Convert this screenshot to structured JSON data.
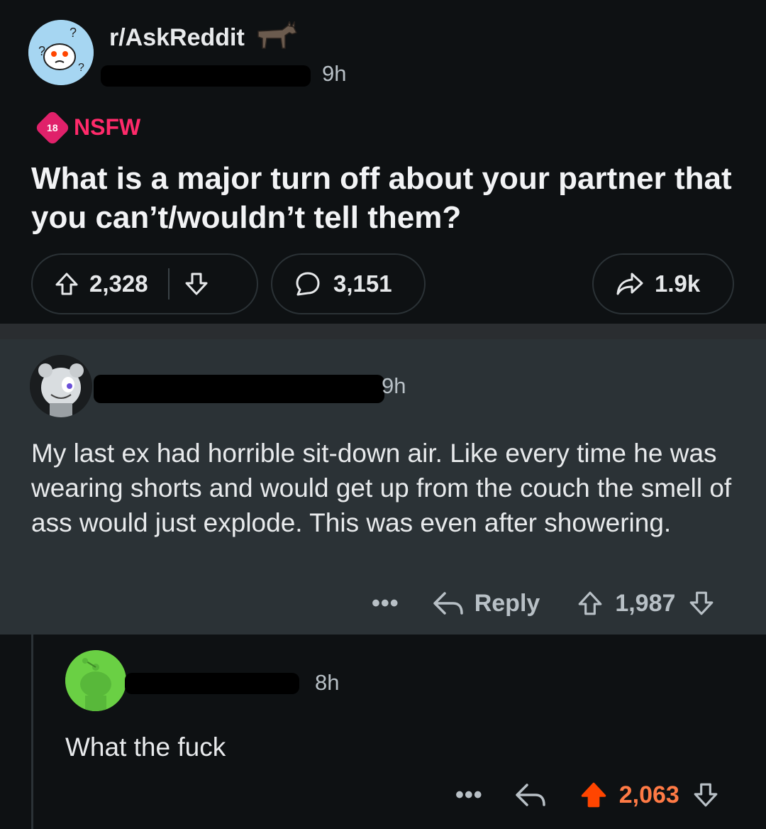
{
  "post": {
    "subreddit": "r/AskReddit",
    "time": "9h",
    "nsfw_badge_number": "18",
    "nsfw_label": "NSFW",
    "title": "What is a major turn off about your partner that you can’t/wouldn’t tell them?",
    "upvotes": "2,328",
    "comments": "3,151",
    "shares": "1.9k"
  },
  "comment_top": {
    "time": "9h",
    "body": "My last ex had horrible sit-down air. Like every time he was wearing shorts and would get up from the couch the smell of ass would just explode. This was even after showering.",
    "more_label": "•••",
    "reply_label": "Reply",
    "score": "1,987"
  },
  "comment_reply": {
    "time": "8h",
    "body": "What the fuck",
    "more_label": "•••",
    "score": "2,063",
    "upvoted": true
  },
  "colors": {
    "background": "#0e1113",
    "comment_highlight": "#2b3236",
    "nsfw": "#ff2a6a",
    "upvote_active": "#ff4500",
    "text_secondary": "#b8c0c6"
  }
}
